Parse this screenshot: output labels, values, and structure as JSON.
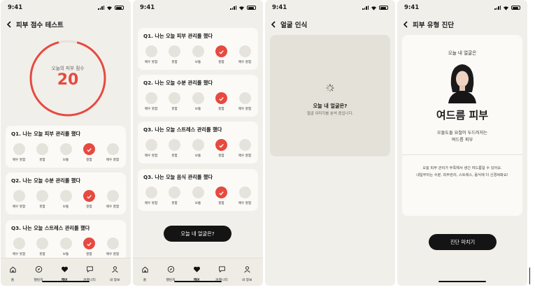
{
  "status": {
    "time": "9:41"
  },
  "screen1": {
    "title": "피부 점수 테스트",
    "score_label": "오늘의 피부 점수",
    "score": "20",
    "questions": [
      {
        "title": "Q1. 나는 오늘 피부 관리를 했다",
        "selected": 3
      },
      {
        "title": "Q2. 나는 오늘 수분 관리를 했다",
        "selected": 3
      },
      {
        "title": "Q3. 나는 오늘 스트레스 관리를 했다",
        "selected": 3
      }
    ]
  },
  "screen2": {
    "questions": [
      {
        "title": "Q1. 나는 오늘 피부 관리를 했다",
        "selected": 3
      },
      {
        "title": "Q2. 나는 오늘 수분 관리를 했다",
        "selected": 3
      },
      {
        "title": "Q3. 나는 오늘 스트레스 관리를 했다",
        "selected": 3
      },
      {
        "title": "Q3. 나는 오늘 음식 관리를 했다",
        "selected": 3
      }
    ],
    "button": "오늘 내 얼굴은?"
  },
  "screen3": {
    "title": "얼굴 인식",
    "loading_title": "오늘 내 얼굴은?",
    "loading_sub": "얼굴 이미지를 분석 중입니다."
  },
  "screen4": {
    "title": "피부 유형 진단",
    "subtitle": "오늘 내 얼굴은",
    "result": "여드름 피부",
    "desc_line1": "오돌도돌 요철이 두드러지는",
    "desc_line2": "여드름 피부",
    "advice_line1": "오늘 피부 관리가 부족해서 생긴 여드름일 수 있어요.",
    "advice_line2": "내일부터는 수분, 피부관리, 스트레스, 음식에 더 신경써봐요!",
    "button": "진단 마치기"
  },
  "options": [
    "매우 못함",
    "못함",
    "보통",
    "잘함",
    "매우 잘함"
  ],
  "tabs": [
    {
      "label": "홈",
      "icon": "home-icon"
    },
    {
      "label": "챌린지",
      "icon": "compass-icon"
    },
    {
      "label": "케어",
      "icon": "heart-icon"
    },
    {
      "label": "커뮤니티",
      "icon": "chat-icon"
    },
    {
      "label": "내 정보",
      "icon": "user-icon"
    }
  ],
  "active_tab": 2,
  "colors": {
    "accent": "#e64a40",
    "background": "#f1efea",
    "card": "#fbfaf7",
    "button": "#141414"
  }
}
